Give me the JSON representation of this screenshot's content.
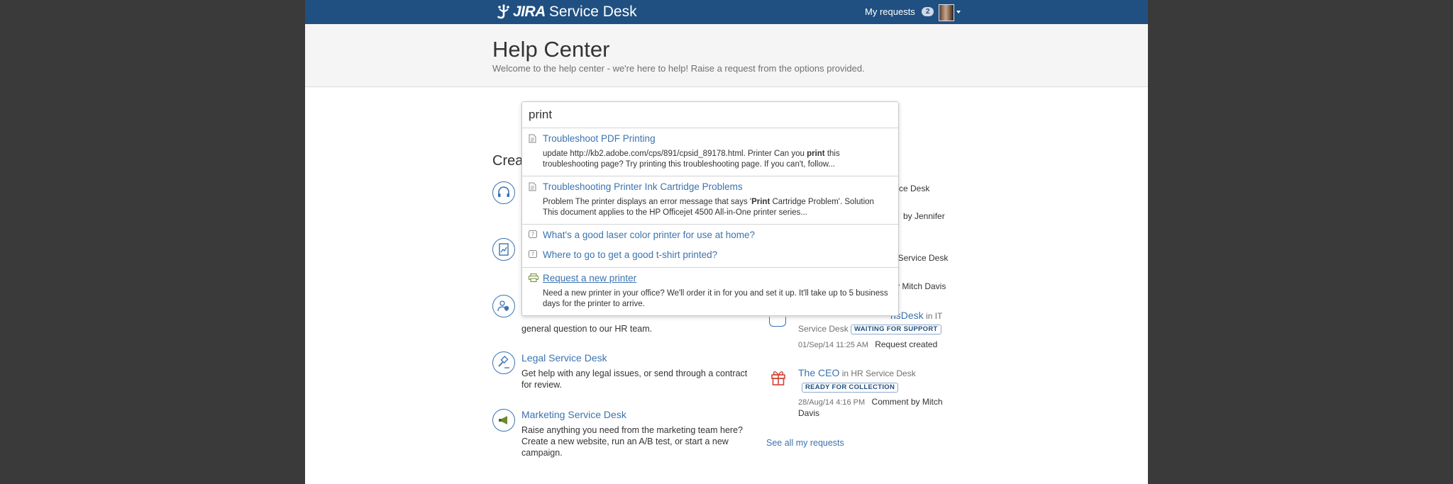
{
  "header": {
    "logo_brand": "JIRA",
    "logo_product": "Service Desk",
    "my_requests_label": "My requests",
    "my_requests_count": "2"
  },
  "hero": {
    "title": "Help Center",
    "subtitle": "Welcome to the help center - we're here to help! Raise a request from the options provided."
  },
  "create": {
    "title": "Crea"
  },
  "services": [
    {
      "title": "",
      "desc": ""
    },
    {
      "title": "",
      "desc": ""
    },
    {
      "title": "",
      "desc": "general question to our HR team."
    },
    {
      "title": "Legal Service Desk",
      "desc": "Get help with any legal issues, or send through a contract for review."
    },
    {
      "title": "Marketing Service Desk",
      "desc": "Raise anything you need from the marketing team here? Create a new website, run an A/B test, or start a new campaign."
    }
  ],
  "requests": [
    {
      "tail_a": "ce Desk",
      "tail_b": "by Jennifer"
    },
    {
      "tail_a": "' Service Desk",
      "tail_b": "y Mitch Davis"
    },
    {
      "title_tail": "nsDesk",
      "in": "in IT",
      "project": "Service Desk",
      "status": "WAITING FOR SUPPORT",
      "date": "01/Sep/14 11:25 AM",
      "activity": "Request created"
    },
    {
      "title": "The CEO",
      "in": "in HR Service Desk",
      "status": "READY FOR COLLECTION",
      "date": "28/Aug/14 4:16 PM",
      "activity": "Comment by Mitch",
      "activity_2": "Davis"
    }
  ],
  "see_all": "See all my requests",
  "search": {
    "value": "print",
    "results": [
      {
        "type": "article",
        "title": "Troubleshoot PDF Printing",
        "desc_1": "update http://kb2.adobe.com/cps/891/cpsid_89178.html. Printer Can you ",
        "desc_bold": "print",
        "desc_2": " this troubleshooting page? Try printing this troubleshooting page. If you can't, follow..."
      },
      {
        "type": "article",
        "title": "Troubleshooting Printer Ink Cartridge Problems",
        "desc_1": "Problem The printer displays an error message that says '",
        "desc_bold": "Print",
        "desc_2": " Cartridge Problem'. Solution This document applies to the HP Officejet 4500 All-in-One printer series..."
      },
      {
        "type": "question",
        "title": "What's a good laser color printer for use at home?"
      },
      {
        "type": "question",
        "title": "Where to go to get a good t-shirt printed?"
      },
      {
        "type": "request",
        "title": "Request a new printer",
        "desc": "Need a new printer in your office? We'll order it in for you and set it up. It'll take up to 5 business days for the printer to arrive."
      }
    ]
  },
  "colors": {
    "topbar": "#205081",
    "link": "#3b73af",
    "backdrop": "#3a3a3a"
  }
}
